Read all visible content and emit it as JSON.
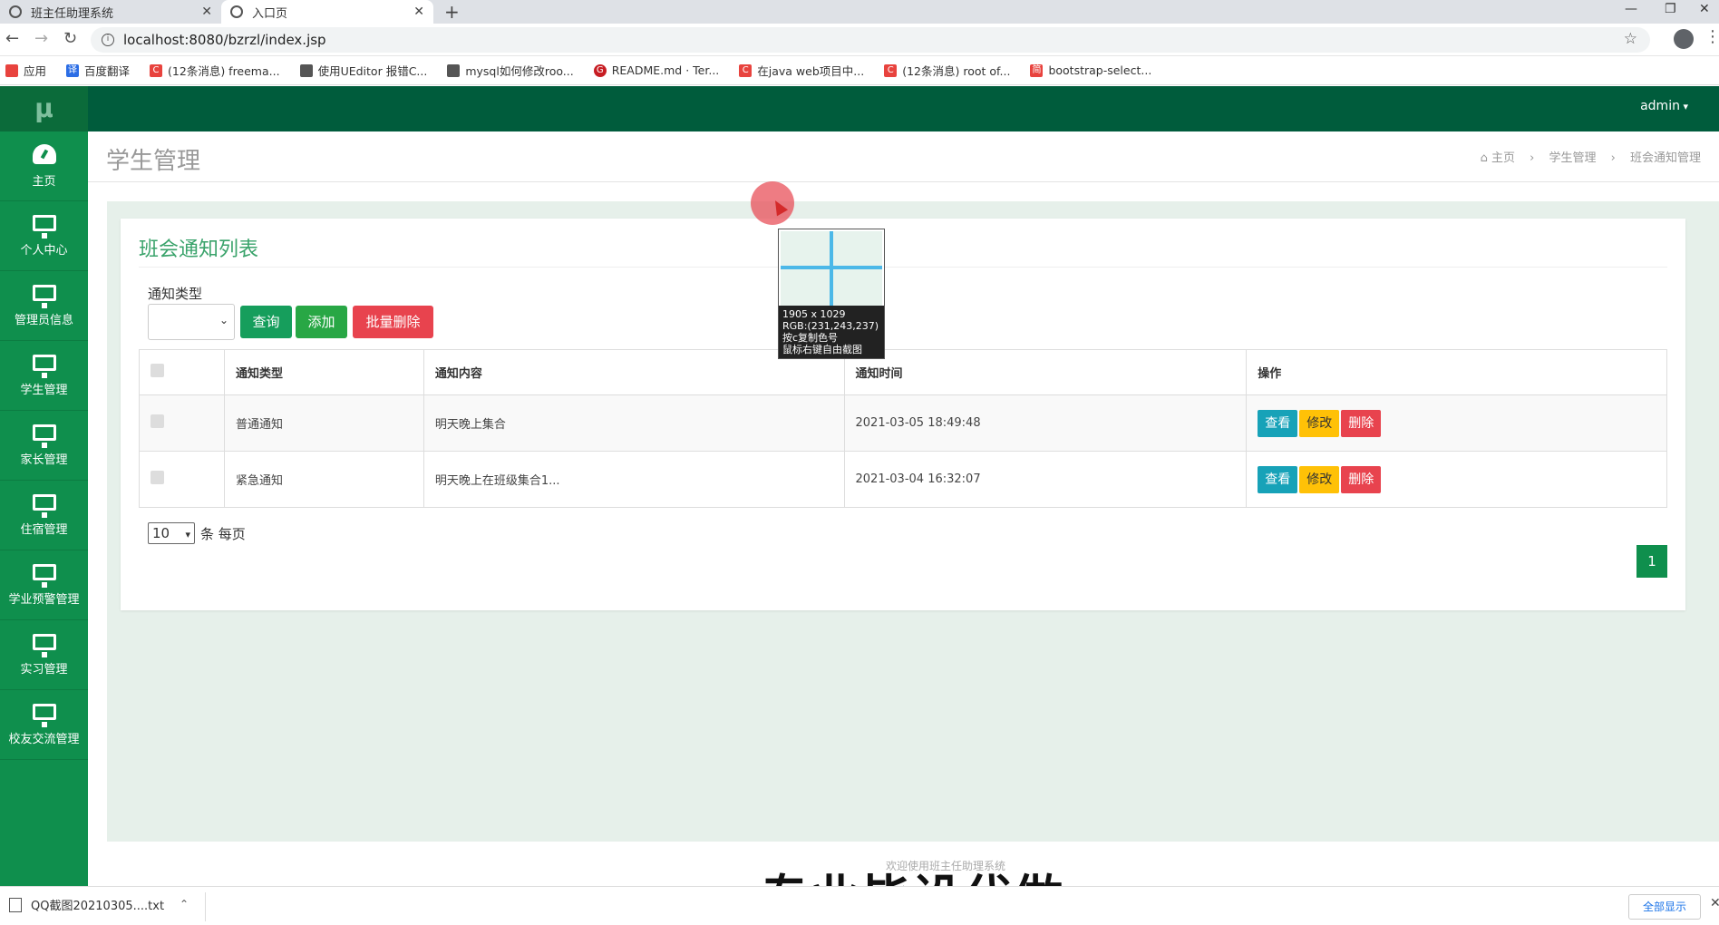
{
  "browser": {
    "tabs": [
      {
        "title": "班主任助理系统",
        "active": false
      },
      {
        "title": "入口页",
        "active": true
      }
    ],
    "url": "localhost:8080/bzrzl/index.jsp",
    "bookmarks": [
      {
        "label": "应用",
        "icon": "apps-grid-icon",
        "color": "#e8433e"
      },
      {
        "label": "百度翻译",
        "icon": "baidu-translate-icon",
        "color": "#2b6de5"
      },
      {
        "label": "(12条消息) freema...",
        "icon": "csdn-icon",
        "color": "#e8433e"
      },
      {
        "label": "使用UEditor 报错C...",
        "icon": "site-icon",
        "color": "#555555"
      },
      {
        "label": "mysql如何修改roo...",
        "icon": "site-icon",
        "color": "#555555"
      },
      {
        "label": "README.md · Ter...",
        "icon": "gitee-icon",
        "color": "#c71d23"
      },
      {
        "label": "在java web项目中...",
        "icon": "csdn-icon",
        "color": "#e8433e"
      },
      {
        "label": "(12条消息) root of...",
        "icon": "csdn-icon",
        "color": "#e8433e"
      },
      {
        "label": "bootstrap-select...",
        "icon": "jianshu-icon",
        "color": "#e8433e"
      }
    ]
  },
  "sidebar": {
    "logo": "μ",
    "items": [
      {
        "label": "主页",
        "icon": "dashboard-icon"
      },
      {
        "label": "个人中心",
        "icon": "monitor-icon"
      },
      {
        "label": "管理员信息",
        "icon": "monitor-icon"
      },
      {
        "label": "学生管理",
        "icon": "monitor-icon"
      },
      {
        "label": "家长管理",
        "icon": "monitor-icon"
      },
      {
        "label": "住宿管理",
        "icon": "monitor-icon"
      },
      {
        "label": "学业预警管理",
        "icon": "monitor-icon"
      },
      {
        "label": "实习管理",
        "icon": "monitor-icon"
      },
      {
        "label": "校友交流管理",
        "icon": "monitor-icon"
      }
    ]
  },
  "topbar": {
    "user": "admin"
  },
  "header": {
    "title": "学生管理",
    "breadcrumb": [
      "主页",
      "学生管理",
      "班会通知管理"
    ]
  },
  "card": {
    "title": "班会通知列表",
    "filter_label": "通知类型",
    "buttons": {
      "query": "查询",
      "add": "添加",
      "batch_delete": "批量删除"
    }
  },
  "table": {
    "headers": [
      "通知类型",
      "通知内容",
      "通知时间",
      "操作"
    ],
    "rows": [
      {
        "type": "普通通知",
        "content": "明天晚上集合",
        "time": "2021-03-05 18:49:48"
      },
      {
        "type": "紧急通知",
        "content": "明天晚上在班级集合1...",
        "time": "2021-03-04 16:32:07"
      }
    ],
    "actions": {
      "view": "查看",
      "edit": "修改",
      "delete": "删除"
    }
  },
  "pagination": {
    "page_size": "10",
    "page_size_suffix": "条 每页",
    "current_page": "1"
  },
  "footer": {
    "text": "欢迎使用班主任助理系统"
  },
  "watermark": "专业毕设代做",
  "screenshot_tool": {
    "size": "1905 x 1029",
    "rgb": "RGB:(231,243,237)",
    "hint_copy": "按c复制色号",
    "hint_right": "鼠标右键自由截图"
  },
  "downloads": {
    "file": "QQ截图20210305....txt",
    "show_all": "全部显示"
  },
  "colors": {
    "primary": "#0f8f4d",
    "topbar": "#005c3c",
    "danger": "#e8434e",
    "warning": "#ffc107",
    "info": "#17a2b8"
  }
}
